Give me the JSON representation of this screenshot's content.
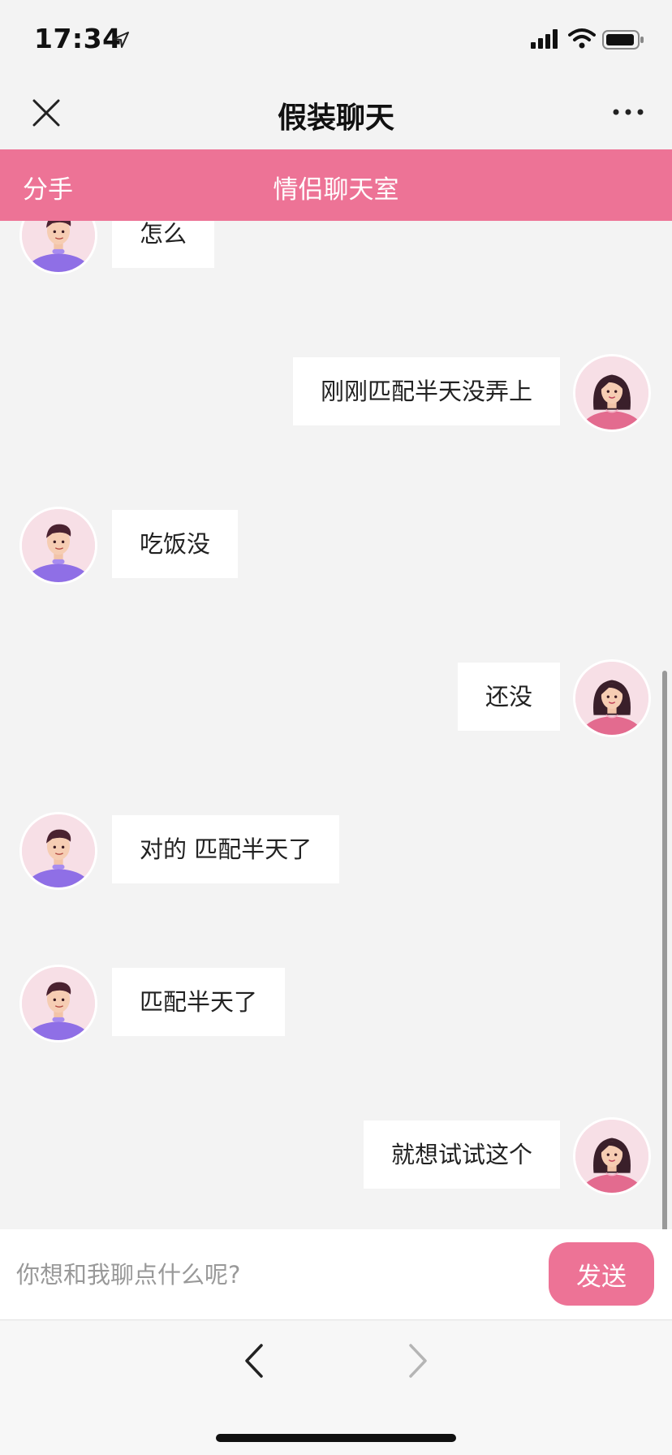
{
  "status_bar": {
    "time": "17:34"
  },
  "nav": {
    "title": "假装聊天"
  },
  "room": {
    "breakup_label": "分手",
    "title": "情侣聊天室"
  },
  "messages": [
    {
      "side": "left",
      "text": "怎么"
    },
    {
      "side": "right",
      "text": "刚刚匹配半天没弄上"
    },
    {
      "side": "left",
      "text": "吃饭没"
    },
    {
      "side": "right",
      "text": "还没"
    },
    {
      "side": "left",
      "text": "对的 匹配半天了"
    },
    {
      "side": "left",
      "text": "匹配半天了"
    },
    {
      "side": "right",
      "text": "就想试试这个"
    }
  ],
  "composer": {
    "placeholder": "你想和我聊点什么呢?",
    "send_label": "发送"
  },
  "colors": {
    "accent": "#ed7396",
    "background": "#f3f3f3",
    "bubble": "#ffffff",
    "boy_shirt": "#8f6fe6",
    "girl_shirt": "#e36b8f"
  },
  "icons": {
    "close": "close-icon",
    "more": "more-icon",
    "back": "back-arrow-icon",
    "forward": "forward-arrow-icon"
  }
}
